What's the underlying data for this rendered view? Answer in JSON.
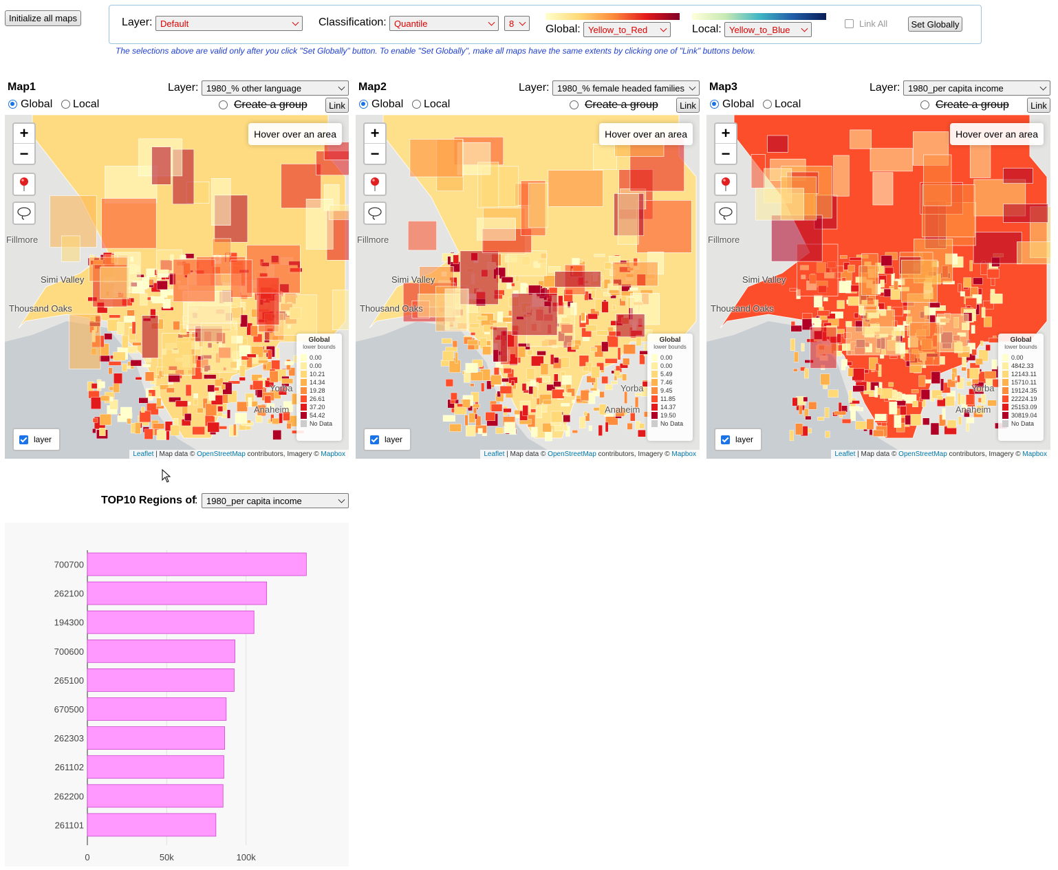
{
  "top": {
    "init_button": "Initialize all maps",
    "layer_label": "Layer:",
    "layer_value": "Default",
    "classification_label": "Classification:",
    "classification_value": "Quantile",
    "classes_value": "8",
    "global_label": "Global:",
    "global_value": "Yellow_to_Red",
    "local_label": "Local:",
    "local_value": "Yellow_to_Blue",
    "link_all_label": "Link All",
    "set_globally_button": "Set Globally",
    "note": "The selections above are valid only after you click \"Set Globally\" button. To enable \"Set Globally\", make all maps have the same extents by clicking one of \"Link\" buttons below."
  },
  "maps": [
    {
      "title": "Map1",
      "layer_label": "Layer:",
      "layer_value": "1980_% other language",
      "global_label": "Global",
      "local_label": "Local",
      "group_label": "Create a group",
      "link_button": "Link",
      "hover_text": "Hover over an area",
      "legend_title": "Global",
      "legend_subtitle": "lower bounds",
      "legend_values": [
        "0.00",
        "0.00",
        "10.21",
        "14.34",
        "19.28",
        "26.61",
        "37.20",
        "54.42",
        "No Data"
      ],
      "layer_toggle": "layer"
    },
    {
      "title": "Map2",
      "layer_label": "Layer:",
      "layer_value": "1980_% female headed families",
      "global_label": "Global",
      "local_label": "Local",
      "group_label": "Create a group",
      "link_button": "Link",
      "hover_text": "Hover over an area",
      "legend_title": "Global",
      "legend_subtitle": "lower bounds",
      "legend_values": [
        "0.00",
        "0.00",
        "5.49",
        "7.46",
        "9.45",
        "11.85",
        "14.37",
        "19.50",
        "No Data"
      ],
      "layer_toggle": "layer"
    },
    {
      "title": "Map3",
      "layer_label": "Layer:",
      "layer_value": "1980_per capita income",
      "global_label": "Global",
      "local_label": "Local",
      "group_label": "Create a group",
      "link_button": "Link",
      "hover_text": "Hover over an area",
      "legend_title": "Global",
      "legend_subtitle": "lower bounds",
      "legend_values": [
        "0.00",
        "4842.33",
        "12143.11",
        "15710.11",
        "19124.35",
        "22224.19",
        "25153.09",
        "30819.04",
        "No Data"
      ],
      "layer_toggle": "layer"
    }
  ],
  "map_common": {
    "places": [
      "Fillmore",
      "Simi Valley",
      "Thousand Oaks",
      "Yorba",
      "Anaheim"
    ],
    "attribution": {
      "leaflet": "Leaflet",
      "sep1": " | Map data © ",
      "osm": "OpenStreetMap",
      "sep2": " contributors, Imagery © ",
      "mapbox": "Mapbox"
    }
  },
  "colors": {
    "legend_swatches": [
      "#ffffcc",
      "#ffeda0",
      "#fed976",
      "#feb24c",
      "#fd8d3c",
      "#fc4e2a",
      "#e31a1c",
      "#b10026",
      "#cccccc"
    ],
    "bar_fill": "#ff99ff",
    "bar_stroke": "#cc44cc",
    "accent": "#1a73e8",
    "red_select": "#dd0000"
  },
  "top10": {
    "label": "TOP10 Regions of",
    "value": "1980_per capita income"
  },
  "chart_data": {
    "type": "bar",
    "orientation": "horizontal",
    "categories": [
      "700700",
      "262100",
      "194300",
      "700600",
      "265100",
      "670500",
      "262303",
      "261102",
      "262200",
      "261101"
    ],
    "values": [
      138000,
      113000,
      105000,
      93000,
      92500,
      87500,
      86500,
      86000,
      85500,
      81000
    ],
    "xticks": [
      "0",
      "50k",
      "100k"
    ],
    "xtick_values": [
      0,
      50000,
      100000
    ],
    "xlim": [
      0,
      163000
    ],
    "grid": true
  }
}
